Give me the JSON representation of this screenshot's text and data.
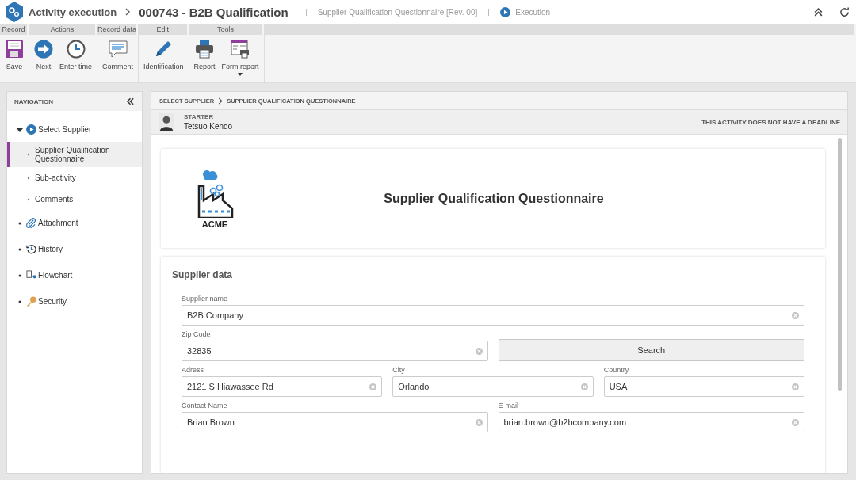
{
  "header": {
    "module": "Activity execution",
    "record": "000743 - B2B Qualification",
    "form": "Supplier Qualification Questionnaire [Rev. 00]",
    "status": "Execution"
  },
  "toolbar": [
    {
      "label": "Record",
      "buttons": [
        {
          "label": "Save",
          "dropdown": false
        }
      ]
    },
    {
      "label": "Actions",
      "buttons": [
        {
          "label": "Next",
          "dropdown": false
        },
        {
          "label": "Enter time",
          "dropdown": false
        }
      ]
    },
    {
      "label": "Record data",
      "buttons": [
        {
          "label": "Comment",
          "dropdown": false
        }
      ]
    },
    {
      "label": "Edit",
      "buttons": [
        {
          "label": "Identification",
          "dropdown": false
        }
      ]
    },
    {
      "label": "Tools",
      "buttons": [
        {
          "label": "Report",
          "dropdown": false
        },
        {
          "label": "Form report",
          "dropdown": true
        }
      ]
    }
  ],
  "navigation": {
    "title": "NAVIGATION",
    "items": [
      {
        "label": "Select Supplier",
        "expanded": true,
        "selected": false,
        "children": [
          {
            "label": "Supplier Qualification Questionnaire",
            "selected": true
          },
          {
            "label": "Sub-activity",
            "selected": false
          },
          {
            "label": "Comments",
            "selected": false
          }
        ]
      },
      {
        "label": "Attachment",
        "expanded": false,
        "selected": false
      },
      {
        "label": "History",
        "expanded": false,
        "selected": false
      },
      {
        "label": "Flowchart",
        "expanded": false,
        "selected": false
      },
      {
        "label": "Security",
        "expanded": false,
        "selected": false
      }
    ]
  },
  "breadcrumb": [
    "SELECT SUPPLIER",
    "SUPPLIER QUALIFICATION QUESTIONNAIRE"
  ],
  "starter": {
    "label": "STARTER",
    "name": "Tetsuo Kendo",
    "deadline": "THIS ACTIVITY DOES NOT HAVE A DEADLINE"
  },
  "form_header": {
    "logo_text": "ACME",
    "title": "Supplier Qualification Questionnaire"
  },
  "section": {
    "title": "Supplier data",
    "rows": [
      {
        "fields": [
          {
            "kind": "field",
            "label": "Supplier name",
            "value": "B2B Company"
          }
        ]
      },
      {
        "fields": [
          {
            "kind": "field",
            "label": "Zip Code",
            "value": "32835"
          },
          {
            "kind": "button",
            "label": "Search"
          }
        ]
      },
      {
        "fields": [
          {
            "kind": "field",
            "label": "Adress",
            "value": "2121 S Hiawassee Rd"
          },
          {
            "kind": "field",
            "label": "City",
            "value": "Orlando"
          },
          {
            "kind": "field",
            "label": "Country",
            "value": "USA"
          }
        ]
      },
      {
        "fields": [
          {
            "kind": "field",
            "label": "Contact Name",
            "value": "Brian Brown"
          },
          {
            "kind": "field",
            "label": "E-mail",
            "value": "brian.brown@b2bcompany.com"
          }
        ]
      }
    ]
  }
}
